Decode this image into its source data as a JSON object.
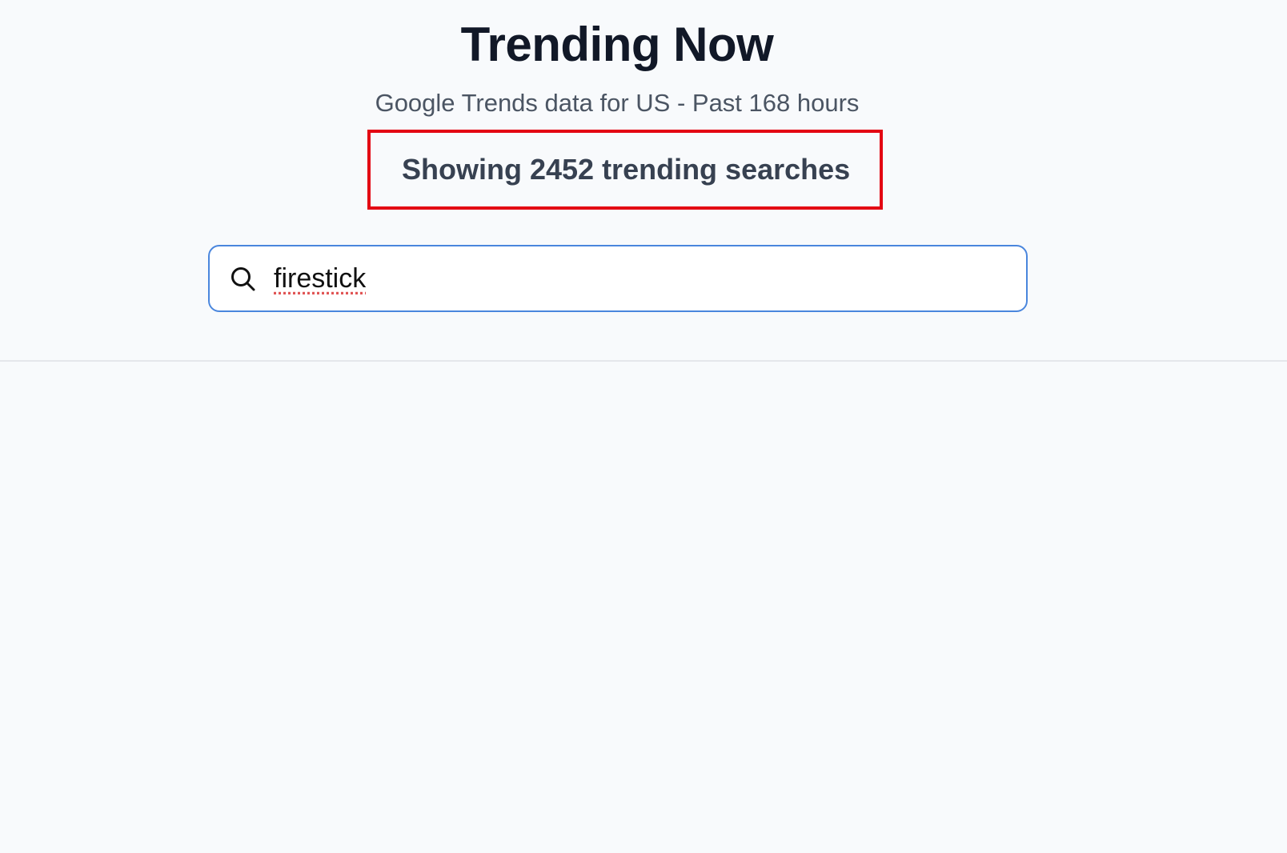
{
  "header": {
    "title": "Trending Now",
    "subtitle": "Google Trends data for US - Past 168 hours",
    "count_text": "Showing 2452 trending searches"
  },
  "search": {
    "value": "firestick",
    "icon": "search-icon"
  },
  "colors": {
    "background": "#f8fafc",
    "title": "#111827",
    "subtitle": "#4b5563",
    "count_text": "#374151",
    "highlight_border": "#e30613",
    "search_border": "#4a86dd"
  }
}
